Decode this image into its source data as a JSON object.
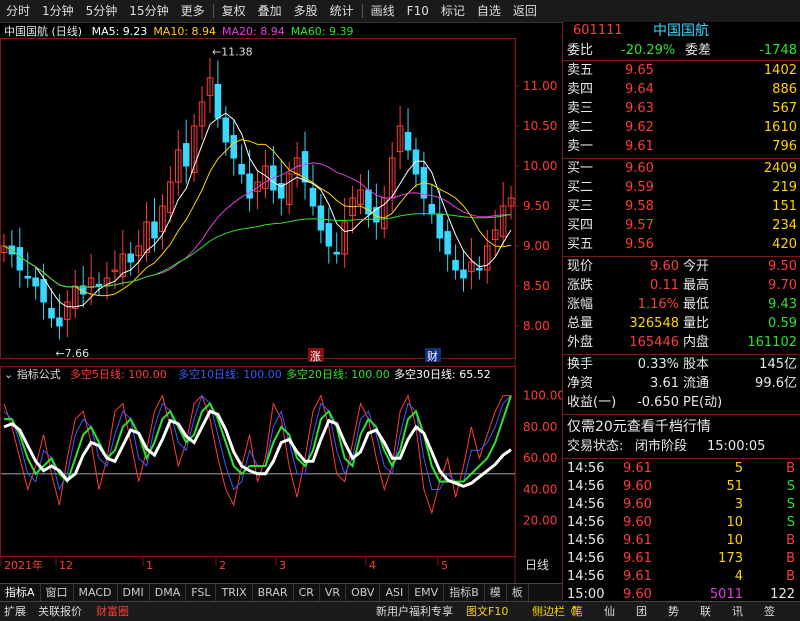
{
  "toolbar": {
    "items": [
      "分时",
      "1分钟",
      "5分钟",
      "15分钟",
      "更多",
      "复权",
      "叠加",
      "多股",
      "统计",
      "画线",
      "F10",
      "标记",
      "自选",
      "返回"
    ]
  },
  "chart": {
    "title": "中国国航 (日线)",
    "ma_labels": [
      {
        "text": "MA5: 9.23",
        "color": "#ffffff"
      },
      {
        "text": "MA10: 8.94",
        "color": "#ffd400"
      },
      {
        "text": "MA20: 8.94",
        "color": "#e040e0"
      },
      {
        "text": "MA60: 9.39",
        "color": "#2ee22e"
      }
    ],
    "high_marker": "11.38",
    "low_marker": "7.66",
    "badge_up": "涨",
    "badge_fin": "财",
    "price_axis": [
      "11.00",
      "10.50",
      "10.00",
      "9.50",
      "9.00",
      "8.50",
      "8.00"
    ],
    "indicator_title": "指标公式",
    "indicator_labels": [
      {
        "text": "多空5日线: 100.00",
        "color": "#ff3b3b"
      },
      {
        "text": "多空10日线: 100.00",
        "color": "#3a5bff"
      },
      {
        "text": "多空20日线: 100.00",
        "color": "#2ee22e"
      },
      {
        "text": "多空30日线: 65.52",
        "color": "#ffffff"
      }
    ],
    "ind_axis": [
      "100.00",
      "80.00",
      "60.00",
      "40.00",
      "20.00"
    ],
    "date_axis": [
      "2021年",
      "12",
      "1",
      "2",
      "3",
      "4",
      "5"
    ],
    "period_label": "日线"
  },
  "chart_data": {
    "type": "line",
    "title": "中国国航 (日线)",
    "ylim": [
      7.6,
      11.6
    ],
    "candles_close": [
      9.0,
      8.9,
      8.7,
      8.6,
      8.5,
      8.3,
      8.1,
      8.0,
      8.3,
      8.5,
      8.4,
      8.6,
      8.5,
      8.6,
      8.7,
      8.9,
      8.8,
      9.0,
      9.3,
      9.1,
      9.5,
      9.8,
      10.2,
      10.0,
      10.5,
      10.8,
      11.1,
      10.6,
      10.3,
      10.1,
      9.9,
      9.6,
      9.8,
      10.0,
      9.7,
      9.6,
      9.9,
      10.1,
      9.8,
      9.5,
      9.2,
      9.0,
      8.9,
      9.3,
      9.6,
      9.7,
      9.4,
      9.3,
      9.6,
      10.1,
      10.5,
      10.2,
      9.9,
      9.6,
      9.4,
      9.1,
      8.9,
      8.7,
      8.6,
      8.8,
      8.7,
      9.0,
      9.2,
      9.5,
      9.6
    ],
    "ind_ylim": [
      0,
      110
    ],
    "series": [
      {
        "name": "多空5日线",
        "values": [
          95,
          80,
          60,
          40,
          55,
          75,
          50,
          30,
          60,
          85,
          90,
          70,
          40,
          60,
          90,
          95,
          70,
          45,
          65,
          90,
          100,
          80,
          55,
          70,
          95,
          100,
          85,
          60,
          40,
          30,
          55,
          75,
          45,
          60,
          95,
          85,
          55,
          35,
          60,
          90,
          100,
          80,
          50,
          45,
          70,
          95,
          85,
          60,
          40,
          55,
          90,
          100,
          80,
          40,
          25,
          45,
          60,
          35,
          55,
          80,
          60,
          75,
          90,
          100,
          100
        ]
      },
      {
        "name": "多空10日线",
        "values": [
          90,
          85,
          70,
          50,
          45,
          65,
          60,
          40,
          50,
          75,
          85,
          80,
          60,
          55,
          75,
          90,
          85,
          60,
          55,
          80,
          95,
          90,
          70,
          65,
          85,
          100,
          95,
          75,
          55,
          40,
          45,
          65,
          55,
          55,
          80,
          90,
          70,
          50,
          50,
          75,
          95,
          90,
          65,
          50,
          60,
          85,
          90,
          75,
          55,
          50,
          75,
          95,
          90,
          60,
          40,
          40,
          50,
          45,
          45,
          65,
          65,
          70,
          80,
          95,
          100
        ]
      },
      {
        "name": "多空20日线",
        "values": [
          85,
          85,
          75,
          60,
          50,
          55,
          60,
          50,
          45,
          60,
          75,
          80,
          70,
          60,
          65,
          80,
          85,
          75,
          60,
          70,
          85,
          90,
          80,
          70,
          75,
          90,
          95,
          85,
          70,
          55,
          50,
          55,
          55,
          55,
          70,
          80,
          75,
          60,
          55,
          65,
          85,
          90,
          80,
          60,
          55,
          75,
          85,
          80,
          65,
          55,
          65,
          85,
          90,
          75,
          55,
          45,
          45,
          45,
          45,
          50,
          55,
          60,
          70,
          85,
          100
        ]
      },
      {
        "name": "多空30日线",
        "values": [
          80,
          82,
          78,
          68,
          58,
          52,
          55,
          52,
          46,
          50,
          62,
          70,
          68,
          60,
          58,
          68,
          78,
          76,
          66,
          62,
          72,
          84,
          82,
          74,
          70,
          80,
          90,
          88,
          78,
          64,
          55,
          52,
          50,
          50,
          58,
          70,
          72,
          64,
          58,
          58,
          72,
          84,
          82,
          70,
          60,
          64,
          76,
          78,
          70,
          60,
          60,
          72,
          80,
          76,
          64,
          52,
          46,
          44,
          42,
          44,
          48,
          52,
          56,
          62,
          65.52
        ]
      }
    ]
  },
  "quote": {
    "code": "601111",
    "name": "中国国航",
    "wei_bi_label": "委比",
    "wei_bi": "-20.29%",
    "wei_cha_label": "委差",
    "wei_cha": "-1748",
    "asks": [
      {
        "label": "卖五",
        "price": "9.65",
        "vol": "1402"
      },
      {
        "label": "卖四",
        "price": "9.64",
        "vol": "886"
      },
      {
        "label": "卖三",
        "price": "9.63",
        "vol": "567"
      },
      {
        "label": "卖二",
        "price": "9.62",
        "vol": "1610"
      },
      {
        "label": "卖一",
        "price": "9.61",
        "vol": "796"
      }
    ],
    "bids": [
      {
        "label": "买一",
        "price": "9.60",
        "vol": "2409"
      },
      {
        "label": "买二",
        "price": "9.59",
        "vol": "219"
      },
      {
        "label": "买三",
        "price": "9.58",
        "vol": "151"
      },
      {
        "label": "买四",
        "price": "9.57",
        "vol": "234"
      },
      {
        "label": "买五",
        "price": "9.56",
        "vol": "420"
      }
    ],
    "stats": [
      {
        "l1": "现价",
        "v1": "9.60",
        "c1": "red",
        "l2": "今开",
        "v2": "9.50",
        "c2": "red"
      },
      {
        "l1": "涨跌",
        "v1": "0.11",
        "c1": "red",
        "l2": "最高",
        "v2": "9.70",
        "c2": "red"
      },
      {
        "l1": "涨幅",
        "v1": "1.16%",
        "c1": "red",
        "l2": "最低",
        "v2": "9.43",
        "c2": "green"
      },
      {
        "l1": "总量",
        "v1": "326548",
        "c1": "yellow",
        "l2": "量比",
        "v2": "0.59",
        "c2": "green"
      },
      {
        "l1": "外盘",
        "v1": "165446",
        "c1": "red",
        "l2": "内盘",
        "v2": "161102",
        "c2": "green"
      }
    ],
    "stats2": [
      {
        "l1": "换手",
        "v1": "0.33%",
        "l2": "股本",
        "v2": "145亿"
      },
      {
        "l1": "净资",
        "v1": "3.61",
        "l2": "流通",
        "v2": "99.6亿"
      },
      {
        "l1": "收益(一)",
        "v1": "-0.650",
        "l2": "PE(动)",
        "v2": ""
      }
    ],
    "promo": "仅需20元查看千档行情",
    "trade_status_label": "交易状态:",
    "trade_status": "闭市阶段",
    "trade_time": "15:00:05",
    "ticks": [
      {
        "t": "14:56",
        "p": "9.61",
        "v": "5",
        "s": "B"
      },
      {
        "t": "14:56",
        "p": "9.60",
        "v": "51",
        "s": "S"
      },
      {
        "t": "14:56",
        "p": "9.60",
        "v": "3",
        "s": "S"
      },
      {
        "t": "14:56",
        "p": "9.60",
        "v": "10",
        "s": "S"
      },
      {
        "t": "14:56",
        "p": "9.61",
        "v": "10",
        "s": "B"
      },
      {
        "t": "14:56",
        "p": "9.61",
        "v": "173",
        "s": "B"
      },
      {
        "t": "14:56",
        "p": "9.61",
        "v": "4",
        "s": "B"
      },
      {
        "t": "15:00",
        "p": "9.60",
        "v": "5011",
        "s": "122"
      }
    ]
  },
  "tabs": [
    "指标A",
    "窗口",
    "MACD",
    "DMI",
    "DMA",
    "FSL",
    "TRIX",
    "BRAR",
    "CR",
    "VR",
    "OBV",
    "ASI",
    "EMV",
    "指标B",
    "模",
    "板"
  ],
  "status": {
    "left": [
      "扩展",
      "关联报价",
      "财富圈"
    ],
    "mid": [
      "新用户福利专享",
      "图文F10",
      "侧边栏《"
    ],
    "icons": [
      "笔",
      "仙",
      "团",
      "势",
      "联",
      "讯",
      "签"
    ]
  }
}
